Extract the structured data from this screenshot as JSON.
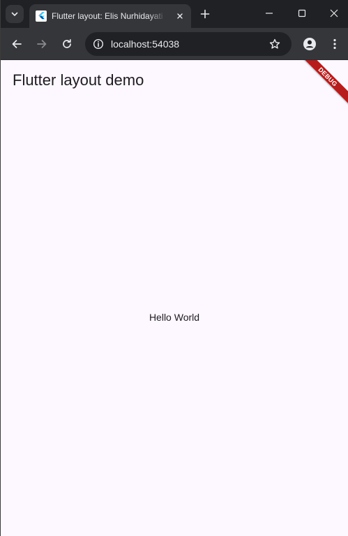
{
  "browser": {
    "tab": {
      "title": "Flutter layout: Elis Nurhidayati -",
      "favicon": "flutter-logo-icon"
    },
    "url": "localhost:54038",
    "icons": {
      "tab_search": "chevron-down-icon",
      "new_tab": "plus-icon",
      "minimize": "minimize-icon",
      "maximize": "maximize-icon",
      "close": "close-icon",
      "back": "arrow-left-icon",
      "forward": "arrow-right-icon",
      "reload": "reload-icon",
      "site_info": "info-icon",
      "bookmark": "star-icon",
      "profile": "profile-icon",
      "menu": "kebab-menu-icon"
    }
  },
  "app": {
    "appbar_title": "Flutter layout demo",
    "body_text": "Hello World",
    "debug_banner": "DEBUG"
  },
  "colors": {
    "page_background": "#fdf7ff",
    "text": "#1d1b20",
    "debug_banner": "#b71c1c",
    "browser_frame": "#202124",
    "toolbar": "#35363a",
    "flutter_blue": "#02569b"
  }
}
